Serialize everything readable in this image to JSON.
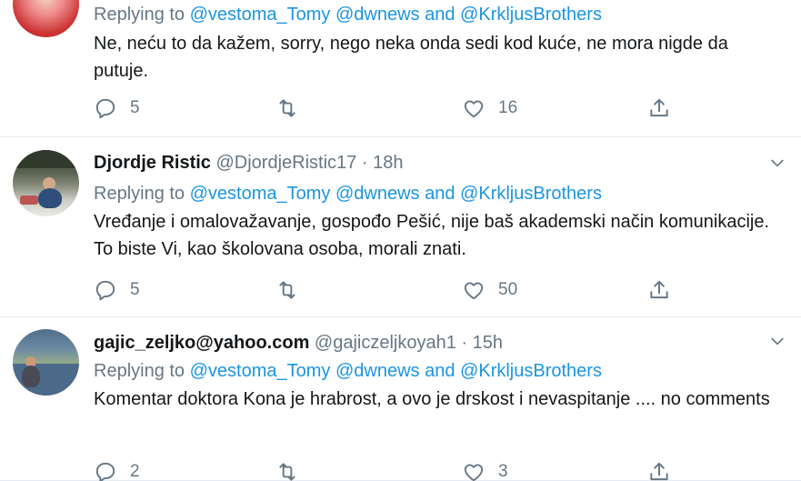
{
  "tweets": [
    {
      "replying_label": "Replying to",
      "mentions": [
        "@vestoma_Tomy",
        "@dwnews",
        "@KrkljusBrothers"
      ],
      "and_label": "and",
      "text": "Ne, neću to da kažem, sorry, nego neka onda sedi kod kuće, ne mora nigde da putuje.",
      "replies": "5",
      "retweets": "",
      "likes": "16"
    },
    {
      "name": "Djordje Ristic",
      "handle": "@DjordjeRistic17",
      "dot": "·",
      "time": "18h",
      "replying_label": "Replying to",
      "mentions": [
        "@vestoma_Tomy",
        "@dwnews",
        "@KrkljusBrothers"
      ],
      "and_label": "and",
      "text": "Vređanje i omalovažavanje, gospođo Pešić, nije baš akademski način komunikacije. To biste Vi, kao školovana osoba, morali znati.",
      "replies": "5",
      "retweets": "",
      "likes": "50"
    },
    {
      "name": "gajic_zeljko@yahoo.com",
      "handle": "@gajiczeljkoyah1",
      "dot": "·",
      "time": "15h",
      "replying_label": "Replying to",
      "mentions": [
        "@vestoma_Tomy",
        "@dwnews",
        "@KrkljusBrothers"
      ],
      "and_label": "and",
      "text": "Komentar doktora Kona je hrabrost, a ovo je drskost i nevaspitanje .... no comments",
      "replies": "2",
      "retweets": "",
      "likes": "3"
    }
  ],
  "icons": {
    "reply": "reply-icon",
    "retweet": "retweet-icon",
    "like": "heart-icon",
    "share": "share-icon",
    "caret": "chevron-down-icon"
  },
  "colors": {
    "link": "#1b95e0",
    "secondary_text": "#657786",
    "primary_text": "#14171a",
    "divider": "#e6ecf0"
  }
}
